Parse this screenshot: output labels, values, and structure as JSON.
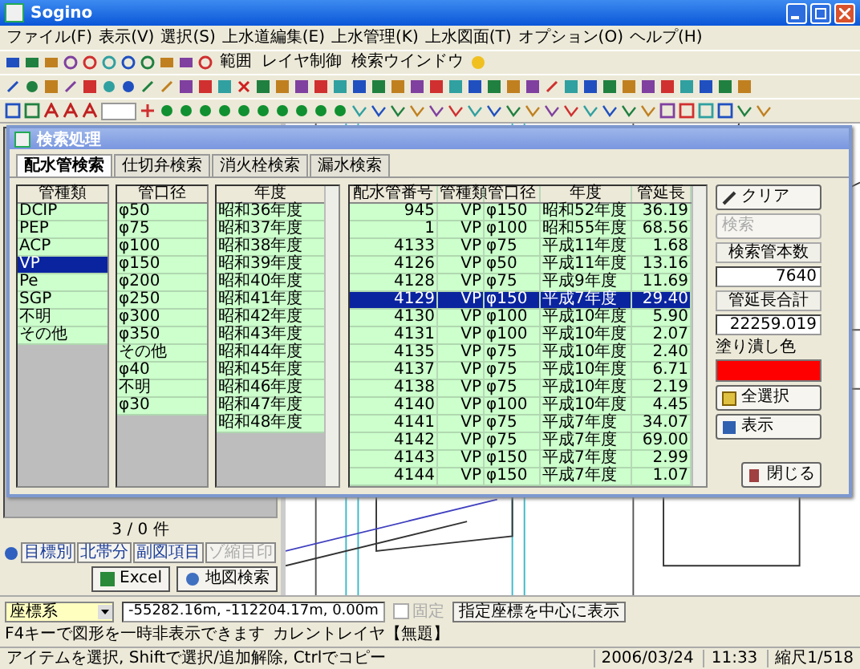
{
  "window": {
    "title": "Sogino"
  },
  "menu": [
    "ファイル(F)",
    "表示(V)",
    "選択(S)",
    "上水道編集(E)",
    "上水管理(K)",
    "上水図面(T)",
    "オプション(O)",
    "ヘルプ(H)"
  ],
  "toolbar_buttons": [
    "範囲",
    "レイヤ制御",
    "検索ウインドウ"
  ],
  "dialog": {
    "title": "検索処理",
    "tabs": [
      {
        "label": "配水管検索",
        "selected": true
      },
      {
        "label": "仕切弁検索",
        "selected": false
      },
      {
        "label": "消火栓検索",
        "selected": false
      },
      {
        "label": "漏水検索",
        "selected": false
      }
    ],
    "lists": [
      {
        "header": "管種類",
        "items": [
          {
            "label": "DCIP",
            "selected": false
          },
          {
            "label": "PEP",
            "selected": false
          },
          {
            "label": "ACP",
            "selected": false
          },
          {
            "label": "VP",
            "selected": true
          },
          {
            "label": "Pe",
            "selected": false
          },
          {
            "label": "SGP",
            "selected": false
          },
          {
            "label": "不明",
            "selected": false
          },
          {
            "label": "その他",
            "selected": false
          }
        ]
      },
      {
        "header": "管口径",
        "items": [
          {
            "label": "φ50",
            "selected": false
          },
          {
            "label": "φ75",
            "selected": false
          },
          {
            "label": "φ100",
            "selected": false
          },
          {
            "label": "φ150",
            "selected": false
          },
          {
            "label": "φ200",
            "selected": false
          },
          {
            "label": "φ250",
            "selected": false
          },
          {
            "label": "φ300",
            "selected": false
          },
          {
            "label": "φ350",
            "selected": false
          },
          {
            "label": "その他",
            "selected": false
          },
          {
            "label": "φ40",
            "selected": false
          },
          {
            "label": "不明",
            "selected": false
          },
          {
            "label": "φ30",
            "selected": false
          }
        ]
      },
      {
        "header": "年度",
        "items": [
          {
            "label": "昭和36年度",
            "selected": false
          },
          {
            "label": "昭和37年度",
            "selected": false
          },
          {
            "label": "昭和38年度",
            "selected": false
          },
          {
            "label": "昭和39年度",
            "selected": false
          },
          {
            "label": "昭和40年度",
            "selected": false
          },
          {
            "label": "昭和41年度",
            "selected": false
          },
          {
            "label": "昭和42年度",
            "selected": false
          },
          {
            "label": "昭和43年度",
            "selected": false
          },
          {
            "label": "昭和44年度",
            "selected": false
          },
          {
            "label": "昭和45年度",
            "selected": false
          },
          {
            "label": "昭和46年度",
            "selected": false
          },
          {
            "label": "昭和47年度",
            "selected": false
          },
          {
            "label": "昭和48年度",
            "selected": false
          }
        ]
      }
    ],
    "table": {
      "columns": [
        "配水管番号",
        "管種類",
        "管口径",
        "年度",
        "管延長"
      ],
      "rows": [
        {
          "cells": [
            "945",
            "VP",
            "φ150",
            "昭和52年度",
            "36.19"
          ],
          "selected": false
        },
        {
          "cells": [
            "1",
            "VP",
            "φ100",
            "昭和55年度",
            "68.56"
          ],
          "selected": false
        },
        {
          "cells": [
            "4133",
            "VP",
            "φ75",
            "平成11年度",
            "1.68"
          ],
          "selected": false
        },
        {
          "cells": [
            "4126",
            "VP",
            "φ50",
            "平成11年度",
            "13.16"
          ],
          "selected": false
        },
        {
          "cells": [
            "4128",
            "VP",
            "φ75",
            "平成9年度",
            "11.69"
          ],
          "selected": false
        },
        {
          "cells": [
            "4129",
            "VP",
            "φ150",
            "平成7年度",
            "29.40"
          ],
          "selected": true
        },
        {
          "cells": [
            "4130",
            "VP",
            "φ100",
            "平成10年度",
            "5.90"
          ],
          "selected": false
        },
        {
          "cells": [
            "4131",
            "VP",
            "φ100",
            "平成10年度",
            "2.07"
          ],
          "selected": false
        },
        {
          "cells": [
            "4135",
            "VP",
            "φ75",
            "平成10年度",
            "2.40"
          ],
          "selected": false
        },
        {
          "cells": [
            "4137",
            "VP",
            "φ75",
            "平成10年度",
            "6.71"
          ],
          "selected": false
        },
        {
          "cells": [
            "4138",
            "VP",
            "φ75",
            "平成10年度",
            "2.19"
          ],
          "selected": false
        },
        {
          "cells": [
            "4140",
            "VP",
            "φ100",
            "平成10年度",
            "4.45"
          ],
          "selected": false
        },
        {
          "cells": [
            "4141",
            "VP",
            "φ75",
            "平成7年度",
            "34.07"
          ],
          "selected": false
        },
        {
          "cells": [
            "4142",
            "VP",
            "φ75",
            "平成7年度",
            "69.00"
          ],
          "selected": false
        },
        {
          "cells": [
            "4143",
            "VP",
            "φ150",
            "平成7年度",
            "2.99"
          ],
          "selected": false
        },
        {
          "cells": [
            "4144",
            "VP",
            "φ150",
            "平成7年度",
            "1.07"
          ],
          "selected": false
        }
      ]
    },
    "clear_button": "クリア",
    "search_button": {
      "label": "検索",
      "disabled": true
    },
    "count": {
      "label": "検索管本数",
      "value": "7640"
    },
    "total_length": {
      "label": "管延長合計",
      "value": "22259.019"
    },
    "fill_color": {
      "label": "塗り潰し色",
      "color": "#ff0000"
    },
    "select_all_button": "全選択",
    "show_button": "表示",
    "close_button": "閉じる"
  },
  "left_panel": {
    "count": "3 / 0 件",
    "buttons": [
      {
        "label": "目標別",
        "disabled": false
      },
      {
        "label": "北帯分",
        "disabled": false
      },
      {
        "label": "副図項目",
        "disabled": false
      },
      {
        "label": "ゾ縮目印",
        "disabled": true
      }
    ],
    "excel_button": "Excel",
    "map_search_button": "地図検索"
  },
  "coord_bar": {
    "system": "座標系",
    "coords": "-55282.16m, -112204.17m, 0.00m",
    "fixed": {
      "label": "固定",
      "checked": false,
      "disabled": true
    },
    "center_button": "指定座標を中心に表示",
    "hint": "F4キーで図形を一時非表示できます",
    "layer": "カレントレイヤ【無題】"
  },
  "status_bar": [
    "アイテムを選択, Shiftで選択/追加解除, Ctrlでコピー",
    "2006/03/24",
    "11:33",
    "縮尺1/518"
  ]
}
